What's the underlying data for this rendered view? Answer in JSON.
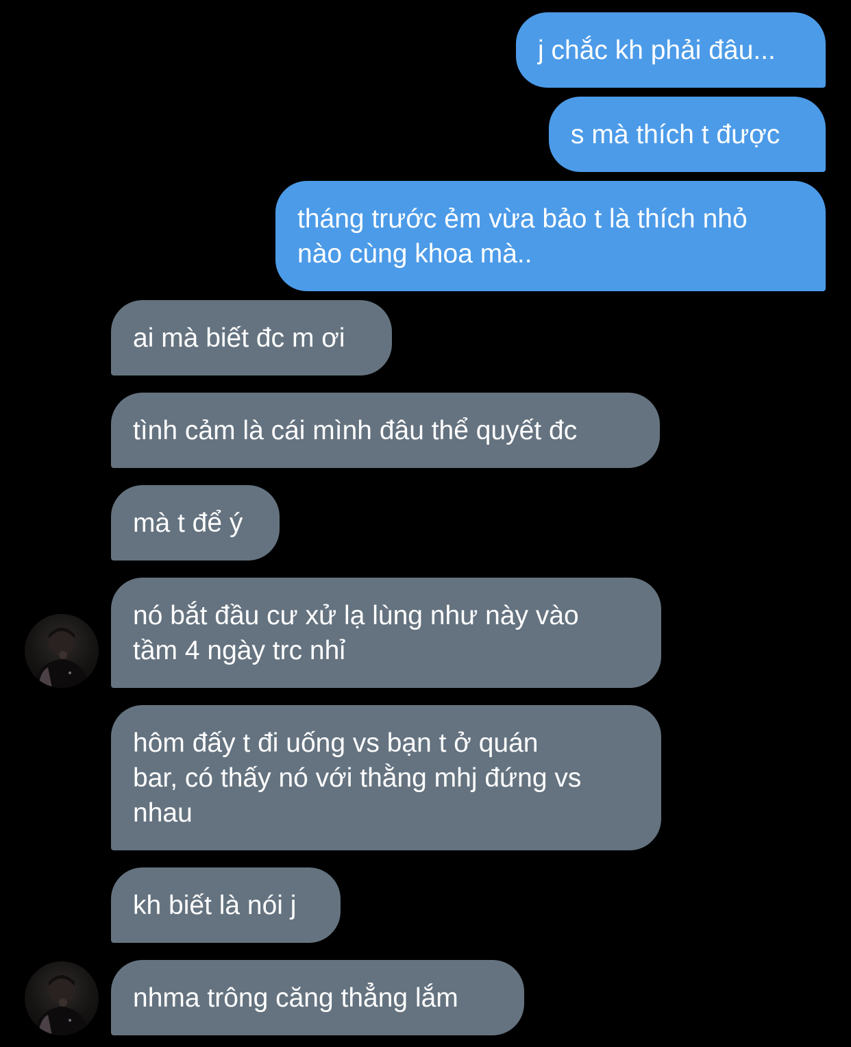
{
  "colors": {
    "background": "#000000",
    "sent_bubble": "#4c9be8",
    "received_bubble": "#657380",
    "text": "#ffffff"
  },
  "messages": [
    {
      "direction": "sent",
      "text": "j chắc kh phải đâu..."
    },
    {
      "direction": "sent",
      "text": "s mà thích t được"
    },
    {
      "direction": "sent",
      "text": "tháng trước ẻm vừa bảo t là thích nhỏ\nnào cùng khoa mà.."
    },
    {
      "direction": "received",
      "text": "ai mà biết đc m ơi"
    },
    {
      "direction": "received",
      "text": "tình cảm là cái mình đâu thể quyết đc"
    },
    {
      "direction": "received",
      "text": "mà t để ý"
    },
    {
      "direction": "received",
      "text": "nó bắt đầu cư xử lạ lùng như này vào\ntầm 4 ngày trc nhỉ",
      "avatar": "contact-avatar"
    },
    {
      "direction": "received",
      "text": "hôm đấy t đi uống vs bạn t ở quán\nbar, có thấy nó với thằng mhj đứng vs\nnhau"
    },
    {
      "direction": "received",
      "text": "kh biết là nói j"
    },
    {
      "direction": "received",
      "text": "nhma trông căng thẳng lắm",
      "avatar": "contact-avatar"
    }
  ]
}
